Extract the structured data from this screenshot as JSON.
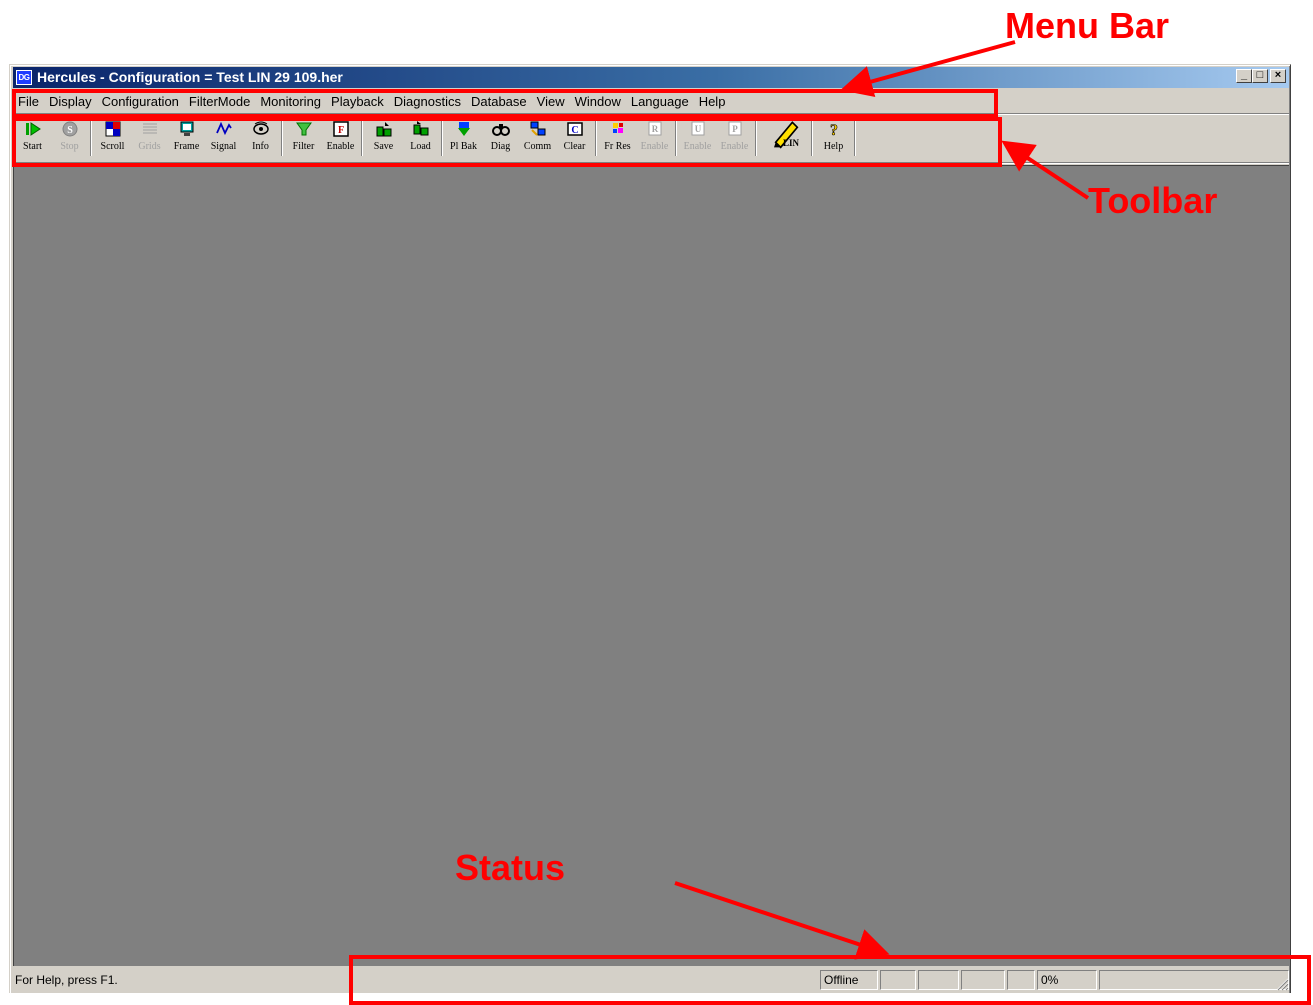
{
  "window": {
    "icon_text": "DG",
    "title": "Hercules - Configuration = Test LIN 29 109.her",
    "controls": {
      "minimize": "_",
      "maximize": "□",
      "close": "×"
    }
  },
  "menubar": {
    "items": [
      "File",
      "Display",
      "Configuration",
      "FilterMode",
      "Monitoring",
      "Playback",
      "Diagnostics",
      "Database",
      "View",
      "Window",
      "Language",
      "Help"
    ]
  },
  "toolbar": {
    "groups": [
      [
        {
          "label": "Start",
          "icon": "start-icon",
          "enabled": true
        },
        {
          "label": "Stop",
          "icon": "stop-icon",
          "enabled": false
        }
      ],
      [
        {
          "label": "Scroll",
          "icon": "scroll-icon",
          "enabled": true
        },
        {
          "label": "Grids",
          "icon": "grids-icon",
          "enabled": false
        },
        {
          "label": "Frame",
          "icon": "frame-icon",
          "enabled": true
        },
        {
          "label": "Signal",
          "icon": "signal-icon",
          "enabled": true
        },
        {
          "label": "Info",
          "icon": "info-icon",
          "enabled": true
        }
      ],
      [
        {
          "label": "Filter",
          "icon": "filter-icon",
          "enabled": true
        },
        {
          "label": "Enable",
          "icon": "enable-f-icon",
          "enabled": true
        }
      ],
      [
        {
          "label": "Save",
          "icon": "save-icon",
          "enabled": true
        },
        {
          "label": "Load",
          "icon": "load-icon",
          "enabled": true
        }
      ],
      [
        {
          "label": "Pl Bak",
          "icon": "playback-icon",
          "enabled": true
        },
        {
          "label": "Diag",
          "icon": "diag-icon",
          "enabled": true
        },
        {
          "label": "Comm",
          "icon": "comm-icon",
          "enabled": true
        },
        {
          "label": "Clear",
          "icon": "clear-icon",
          "enabled": true
        }
      ],
      [
        {
          "label": "Fr Res",
          "icon": "frame-response-icon",
          "enabled": true
        },
        {
          "label": "Enable",
          "icon": "enable-r-icon",
          "enabled": false
        }
      ],
      [
        {
          "label": "Enable",
          "icon": "enable-u-icon",
          "enabled": false
        },
        {
          "label": "Enable",
          "icon": "enable-p-icon",
          "enabled": false
        }
      ],
      [
        {
          "label": "LIN",
          "icon": "lin-pencil-icon",
          "enabled": true
        }
      ],
      [
        {
          "label": "Help",
          "icon": "help-icon",
          "enabled": true
        }
      ]
    ]
  },
  "statusbar": {
    "help_text": "For Help, press F1.",
    "connection": "Offline",
    "progress": "0%"
  },
  "annotations": {
    "menu_bar": "Menu Bar",
    "toolbar": "Toolbar",
    "status": "Status"
  },
  "colors": {
    "annotation": "#ff0000",
    "title_gradient_start": "#0a246a",
    "title_gradient_end": "#a6caf0",
    "client_bg": "#808080",
    "chrome_bg": "#d4d0c8"
  }
}
